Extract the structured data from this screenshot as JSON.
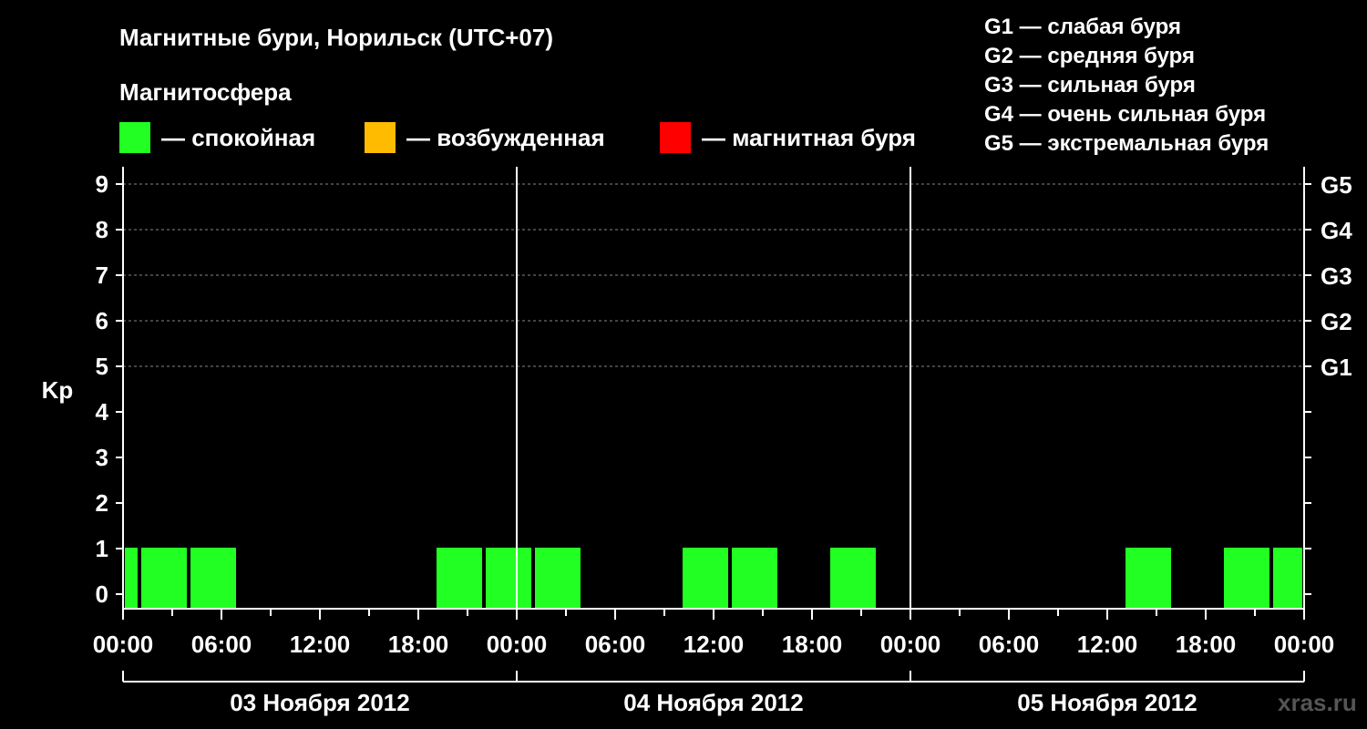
{
  "title": "Магнитные бури, Норильск (UTC+07)",
  "subtitle": "Магнитосфера",
  "legend": [
    {
      "label": "— спокойная",
      "color": "#22ff22"
    },
    {
      "label": "— возбужденная",
      "color": "#ffbb00"
    },
    {
      "label": "— магнитная буря",
      "color": "#ff0000"
    }
  ],
  "g_scale": [
    "G1 — слабая буря",
    "G2 — средняя буря",
    "G3 — сильная буря",
    "G4 — очень сильная буря",
    "G5 — экстремальная буря"
  ],
  "watermark": "xras.ru",
  "chart_data": {
    "type": "bar",
    "ylabel": "Kp",
    "ylim": [
      0,
      9
    ],
    "yticks": [
      "0",
      "1",
      "2",
      "3",
      "4",
      "5",
      "6",
      "7",
      "8",
      "9"
    ],
    "right_ticks": [
      {
        "kp": 5,
        "label": "G1"
      },
      {
        "kp": 6,
        "label": "G2"
      },
      {
        "kp": 7,
        "label": "G3"
      },
      {
        "kp": 8,
        "label": "G4"
      },
      {
        "kp": 9,
        "label": "G5"
      }
    ],
    "xlim_hours": [
      0,
      72
    ],
    "xtick_labels": [
      "00:00",
      "06:00",
      "12:00",
      "18:00",
      "00:00",
      "06:00",
      "12:00",
      "18:00",
      "00:00",
      "06:00",
      "12:00",
      "18:00",
      "00:00"
    ],
    "days": [
      "03 Ноября 2012",
      "04 Ноября 2012",
      "05 Ноября 2012"
    ],
    "grid": "dashed horizontal lines at Kp 5-9",
    "bar_color": "#22ff22",
    "bars": [
      {
        "start": 0,
        "end": 1,
        "kp": 1
      },
      {
        "start": 1,
        "end": 4,
        "kp": 1
      },
      {
        "start": 4,
        "end": 7,
        "kp": 1
      },
      {
        "start": 19,
        "end": 22,
        "kp": 1
      },
      {
        "start": 22,
        "end": 25,
        "kp": 1
      },
      {
        "start": 25,
        "end": 28,
        "kp": 1
      },
      {
        "start": 34,
        "end": 37,
        "kp": 1
      },
      {
        "start": 37,
        "end": 40,
        "kp": 1
      },
      {
        "start": 43,
        "end": 46,
        "kp": 1
      },
      {
        "start": 61,
        "end": 64,
        "kp": 1
      },
      {
        "start": 67,
        "end": 70,
        "kp": 1
      },
      {
        "start": 70,
        "end": 72,
        "kp": 1
      }
    ]
  }
}
